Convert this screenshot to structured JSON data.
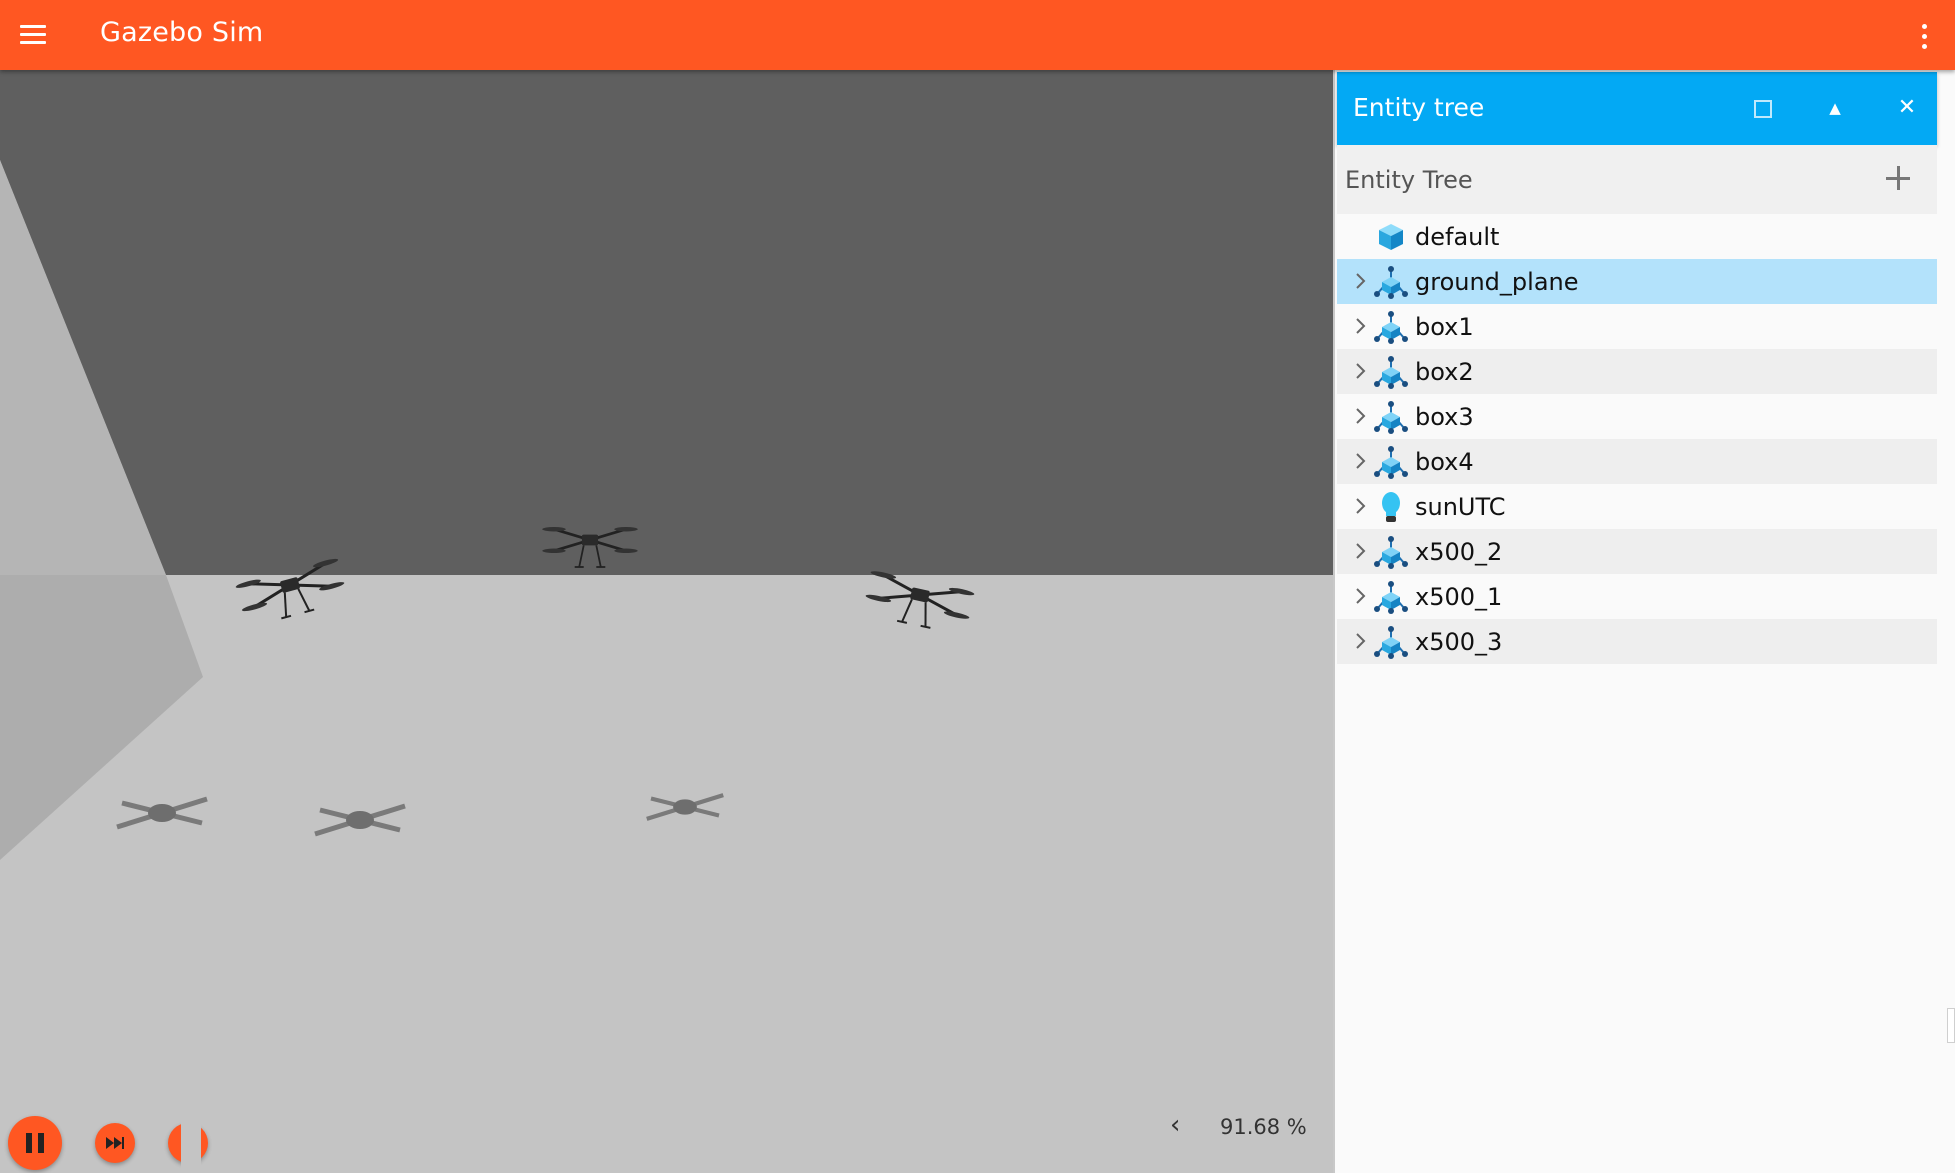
{
  "app": {
    "title": "Gazebo Sim"
  },
  "viewport": {
    "real_time_factor": "91.68 %",
    "colors": {
      "sky": "#5f5f5f",
      "ground": "#c4c4c4",
      "wall": "#adadad",
      "accent": "#ff5722"
    }
  },
  "panel": {
    "title": "Entity tree",
    "header_color": "#03a9f4",
    "tree_title": "Entity Tree",
    "items": [
      {
        "label": "default",
        "icon": "world-cube-icon",
        "expandable": false,
        "selected": false
      },
      {
        "label": "ground_plane",
        "icon": "model-icon",
        "expandable": true,
        "selected": true
      },
      {
        "label": "box1",
        "icon": "model-icon",
        "expandable": true,
        "selected": false
      },
      {
        "label": "box2",
        "icon": "model-icon",
        "expandable": true,
        "selected": false
      },
      {
        "label": "box3",
        "icon": "model-icon",
        "expandable": true,
        "selected": false
      },
      {
        "label": "box4",
        "icon": "model-icon",
        "expandable": true,
        "selected": false
      },
      {
        "label": "sunUTC",
        "icon": "light-bulb-icon",
        "expandable": true,
        "selected": false
      },
      {
        "label": "x500_2",
        "icon": "model-icon",
        "expandable": true,
        "selected": false
      },
      {
        "label": "x500_1",
        "icon": "model-icon",
        "expandable": true,
        "selected": false
      },
      {
        "label": "x500_3",
        "icon": "model-icon",
        "expandable": true,
        "selected": false
      }
    ]
  }
}
